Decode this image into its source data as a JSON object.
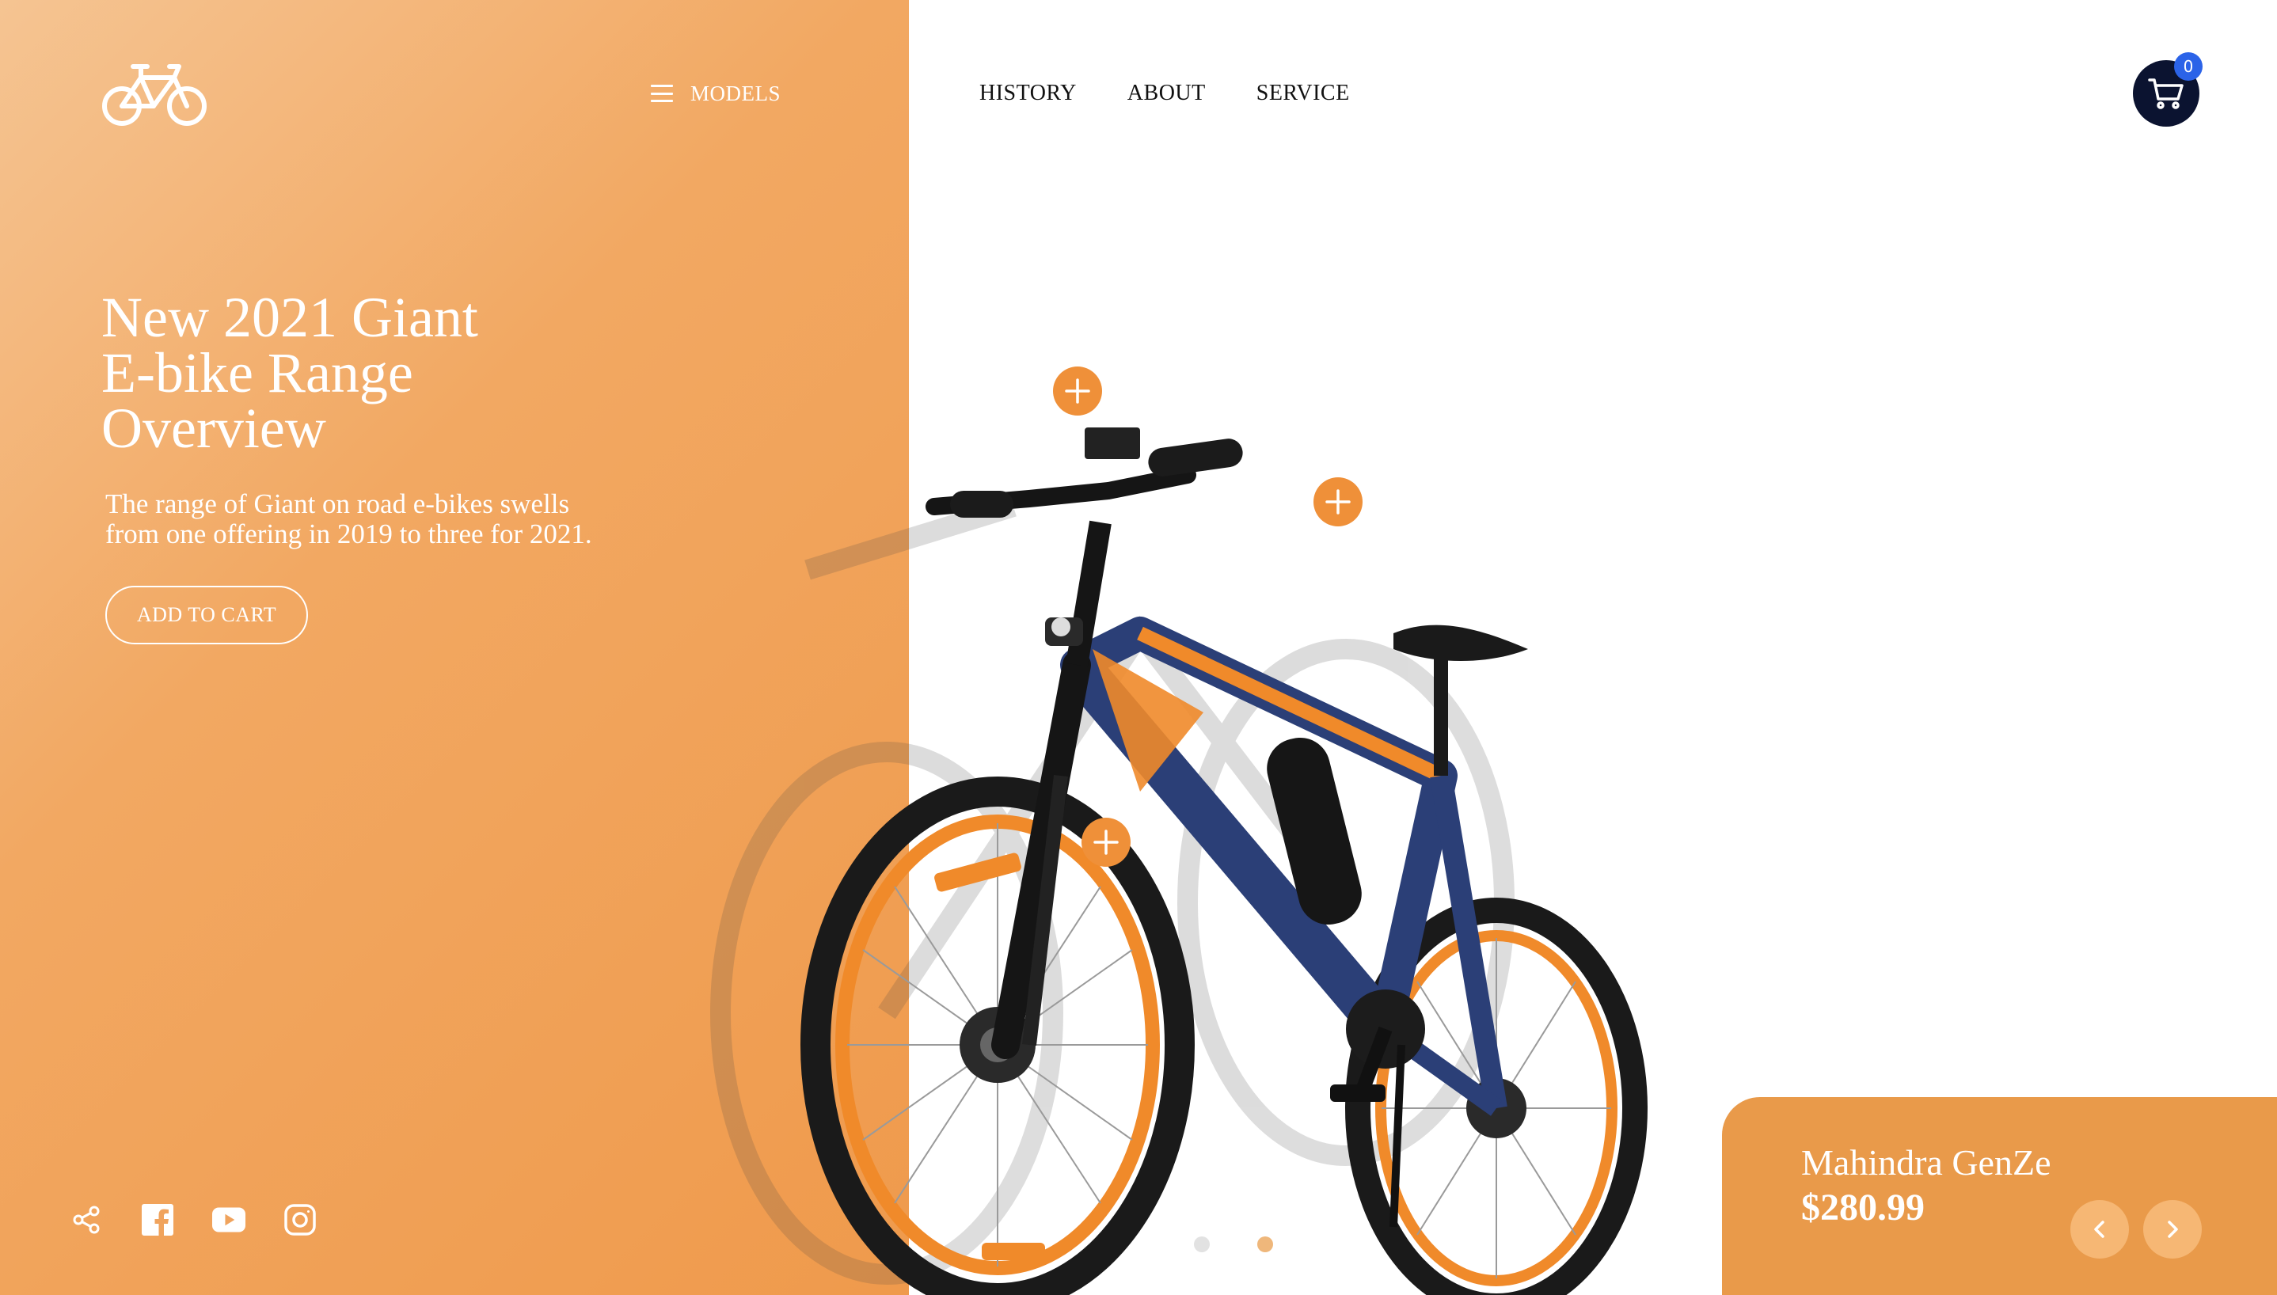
{
  "nav": {
    "models_label": "MODELS",
    "links": [
      "HISTORY",
      "ABOUT",
      "SERVICE"
    ]
  },
  "cart": {
    "count": "0"
  },
  "hero": {
    "title_lines": [
      "New 2021 Giant",
      "E-bike Range",
      "Overview"
    ],
    "subtitle_lines": [
      "The range of Giant on road e-bikes swells",
      "from one offering in 2019 to three for 2021."
    ],
    "cta_label": "ADD TO CART"
  },
  "social": [
    "share-icon",
    "facebook-icon",
    "youtube-icon",
    "instagram-icon"
  ],
  "product": {
    "name": "Mahindra GenZe",
    "price": "$280.99"
  },
  "slider": {
    "dot_count": 2,
    "active_index": 1
  },
  "colors": {
    "panel_gradient": [
      "#f5c492",
      "#ef9a4c"
    ],
    "accent": "#ef9039",
    "cart_bg": "#0b1330",
    "badge": "#2b63e8",
    "card": "#e99a4a"
  }
}
